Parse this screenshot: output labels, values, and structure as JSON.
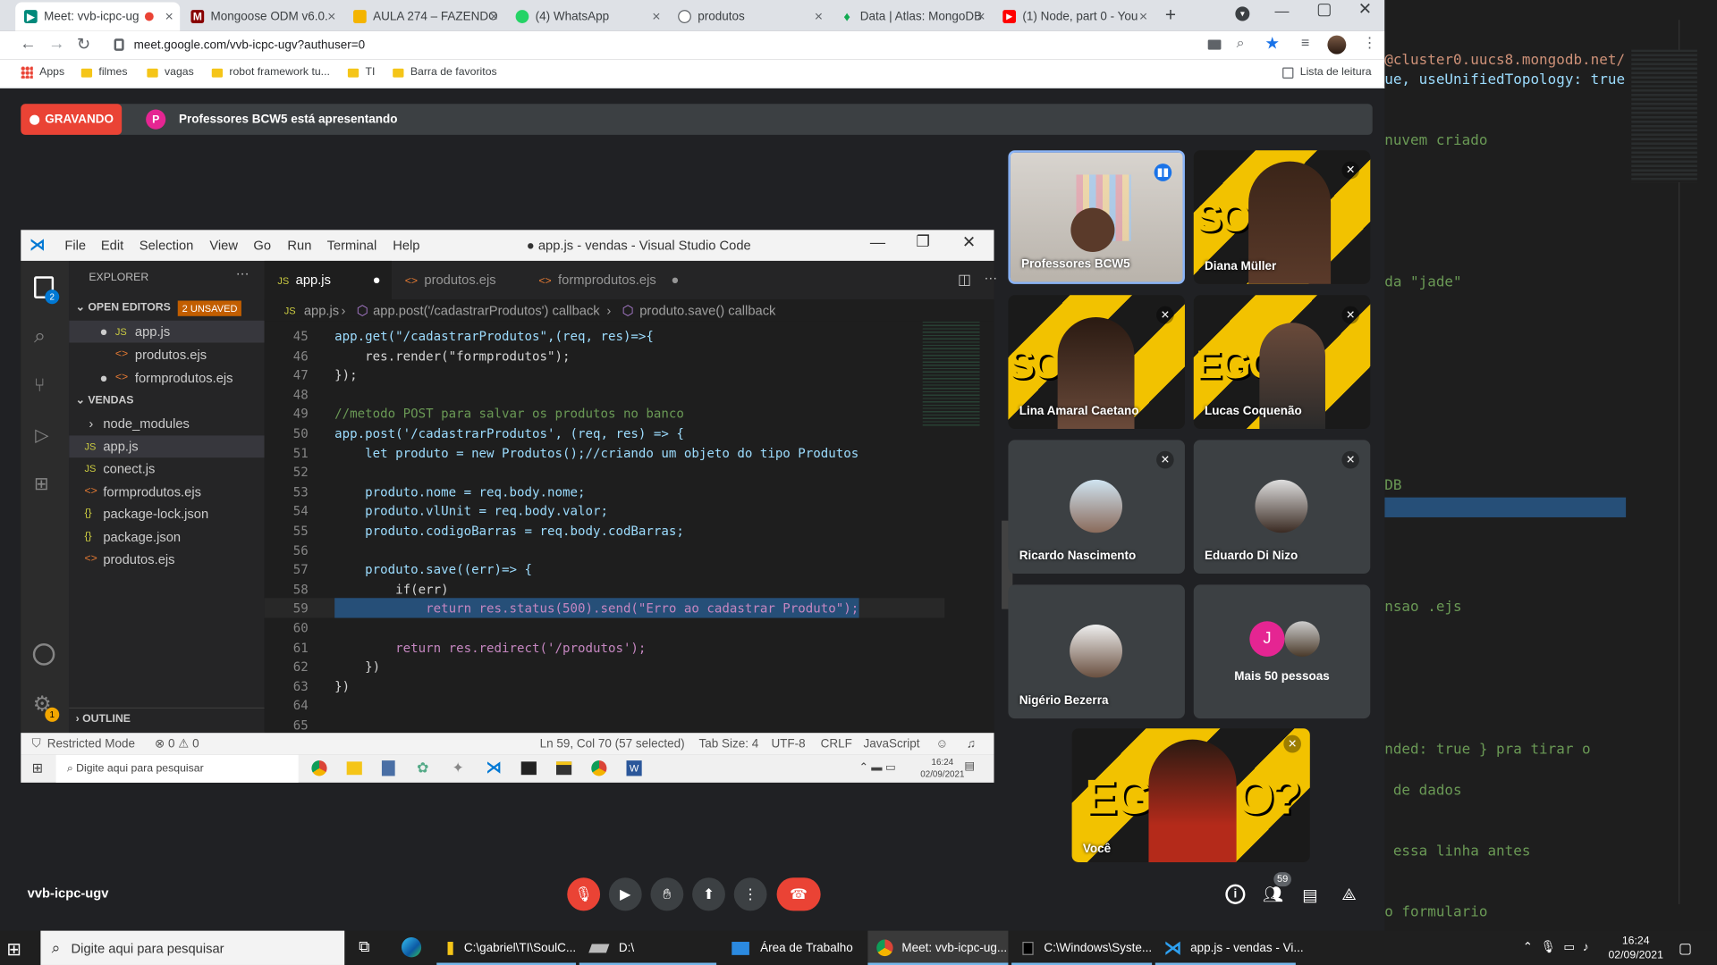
{
  "browser": {
    "tabs": [
      {
        "title": "Meet: vvb-icpc-ug",
        "icon": "google-meet-icon",
        "active": true,
        "recording": true
      },
      {
        "title": "Mongoose ODM v6.0.",
        "icon": "mongoose-icon"
      },
      {
        "title": "AULA 274 – FAZENDO",
        "icon": "google-slides-icon"
      },
      {
        "title": "(4) WhatsApp",
        "icon": "whatsapp-icon"
      },
      {
        "title": "produtos",
        "icon": "globe-icon"
      },
      {
        "title": "Data | Atlas: MongoDB",
        "icon": "mongodb-leaf-icon"
      },
      {
        "title": "(1) Node, part 0 - You",
        "icon": "youtube-icon"
      }
    ],
    "url": "meet.google.com/vvb-icpc-ugv?authuser=0",
    "bookmarks": [
      "Apps",
      "filmes",
      "vagas",
      "robot framework tu...",
      "TI",
      "Barra de favoritos"
    ],
    "reading_list": "Lista de leitura"
  },
  "meet": {
    "recording_label": "GRAVANDO",
    "presenter_initial": "P",
    "presenting_text": "Professores BCW5 está apresentando",
    "meeting_code": "vvb-icpc-ugv",
    "participant_count_badge": "59",
    "participants": [
      {
        "name": "Professores BCW5",
        "speaking": true
      },
      {
        "name": "Diana Müller"
      },
      {
        "name": "Lina Amaral Caetano"
      },
      {
        "name": "Lucas Coquenão"
      },
      {
        "name": "Ricardo Nascimento"
      },
      {
        "name": "Eduardo Di Nizo"
      },
      {
        "name": "Nigério Bezerra"
      },
      {
        "name": "Mais 50 pessoas",
        "initial": "J"
      },
      {
        "name": "Você"
      }
    ],
    "controls": [
      "mic-off-icon",
      "camera-icon",
      "raise-hand-icon",
      "present-icon",
      "more-options-icon",
      "end-call-icon"
    ],
    "side_controls": [
      "info-icon",
      "people-icon",
      "chat-icon",
      "activities-icon"
    ],
    "colors": {
      "recording": "#ea4335",
      "end_call": "#ea4335",
      "mic_off": "#ea4335",
      "background": "#202124"
    }
  },
  "vscode": {
    "menu": [
      "File",
      "Edit",
      "Selection",
      "View",
      "Go",
      "Run",
      "Terminal",
      "Help"
    ],
    "title": "● app.js - vendas - Visual Studio Code",
    "explorer_label": "EXPLORER",
    "open_editors_label": "OPEN EDITORS",
    "unsaved_badge": "2 UNSAVED",
    "open_editors": [
      "app.js",
      "produtos.ejs",
      "formprodutos.ejs"
    ],
    "project_label": "VENDAS",
    "files": [
      "node_modules",
      "app.js",
      "conect.js",
      "formprodutos.ejs",
      "package-lock.json",
      "package.json",
      "produtos.ejs"
    ],
    "outline_label": "OUTLINE",
    "tabs": [
      {
        "label": "app.js",
        "dirty": true,
        "active": true
      },
      {
        "label": "produtos.ejs"
      },
      {
        "label": "formprodutos.ejs",
        "dirty": true
      }
    ],
    "breadcrumb": [
      "app.js",
      "app.post('/cadastrarProdutos') callback",
      "produto.save() callback"
    ],
    "code_lines": [
      {
        "n": "45",
        "t": "app.get(\"/cadastrarProdutos\",(req, res)=>{"
      },
      {
        "n": "46",
        "t": "    res.render(\"formprodutos\");"
      },
      {
        "n": "47",
        "t": "});"
      },
      {
        "n": "48",
        "t": ""
      },
      {
        "n": "49",
        "t": "//metodo POST para salvar os produtos no banco"
      },
      {
        "n": "50",
        "t": "app.post('/cadastrarProdutos', (req, res) => {"
      },
      {
        "n": "51",
        "t": "    let produto = new Produtos();//criando um objeto do tipo Produtos"
      },
      {
        "n": "52",
        "t": ""
      },
      {
        "n": "53",
        "t": "    produto.nome = req.body.nome;"
      },
      {
        "n": "54",
        "t": "    produto.vlUnit = req.body.valor;"
      },
      {
        "n": "55",
        "t": "    produto.codigoBarras = req.body.codBarras;"
      },
      {
        "n": "56",
        "t": ""
      },
      {
        "n": "57",
        "t": "    produto.save((err)=> {"
      },
      {
        "n": "58",
        "t": "        if(err)"
      },
      {
        "n": "59",
        "t": "            return res.status(500).send(\"Erro ao cadastrar Produto\");"
      },
      {
        "n": "60",
        "t": ""
      },
      {
        "n": "61",
        "t": "        return res.redirect('/produtos');"
      },
      {
        "n": "62",
        "t": "    })"
      },
      {
        "n": "63",
        "t": "})"
      },
      {
        "n": "64",
        "t": ""
      },
      {
        "n": "65",
        "t": ""
      }
    ],
    "status": {
      "mode": "Restricted Mode",
      "problems": "⊗ 0 ⚠ 0",
      "cursor": "Ln 59, Col 70 (57 selected)",
      "tab_size": "Tab Size: 4",
      "encoding": "UTF-8",
      "eol": "CRLF",
      "language": "JavaScript"
    },
    "inner_taskbar": {
      "search": "Digite aqui para pesquisar",
      "time": "16:24",
      "date": "02/09/2021"
    },
    "badges": {
      "explorer": "2",
      "settings": "1"
    }
  },
  "right_editor": {
    "lines": [
      {
        "t": "@cluster0.uucs8.mongodb.net/",
        "c": "c-str"
      },
      {
        "t": "ue, useUnifiedTopology: true",
        "c": "c-var"
      },
      {
        "t": "nuvem criado",
        "c": "c-com"
      },
      {
        "t": "da \"jade\"",
        "c": "c-com"
      },
      {
        "t": "DB",
        "c": "c-com"
      },
      {
        "t": "nsao .ejs",
        "c": "c-com"
      },
      {
        "t": "nded: true } pra tirar o",
        "c": "c-com"
      },
      {
        "t": " de dados",
        "c": "c-com"
      },
      {
        "t": " essa linha antes",
        "c": "c-com"
      },
      {
        "t": "o formulario",
        "c": "c-com"
      }
    ]
  },
  "taskbar": {
    "search": "Digite aqui para pesquisar",
    "apps": [
      {
        "label": "C:\\gabriel\\TI\\SoulC...",
        "icon": "folder-icon"
      },
      {
        "label": "D:\\",
        "icon": "drive-icon"
      },
      {
        "label": "Área de Trabalho",
        "icon": "desktop-icon"
      },
      {
        "label": "Meet: vvb-icpc-ug...",
        "icon": "chrome-icon",
        "active": true
      },
      {
        "label": "C:\\Windows\\Syste...",
        "icon": "cmd-icon"
      },
      {
        "label": "app.js - vendas - Vi...",
        "icon": "vscode-icon"
      }
    ],
    "time": "16:24",
    "date": "02/09/2021"
  }
}
